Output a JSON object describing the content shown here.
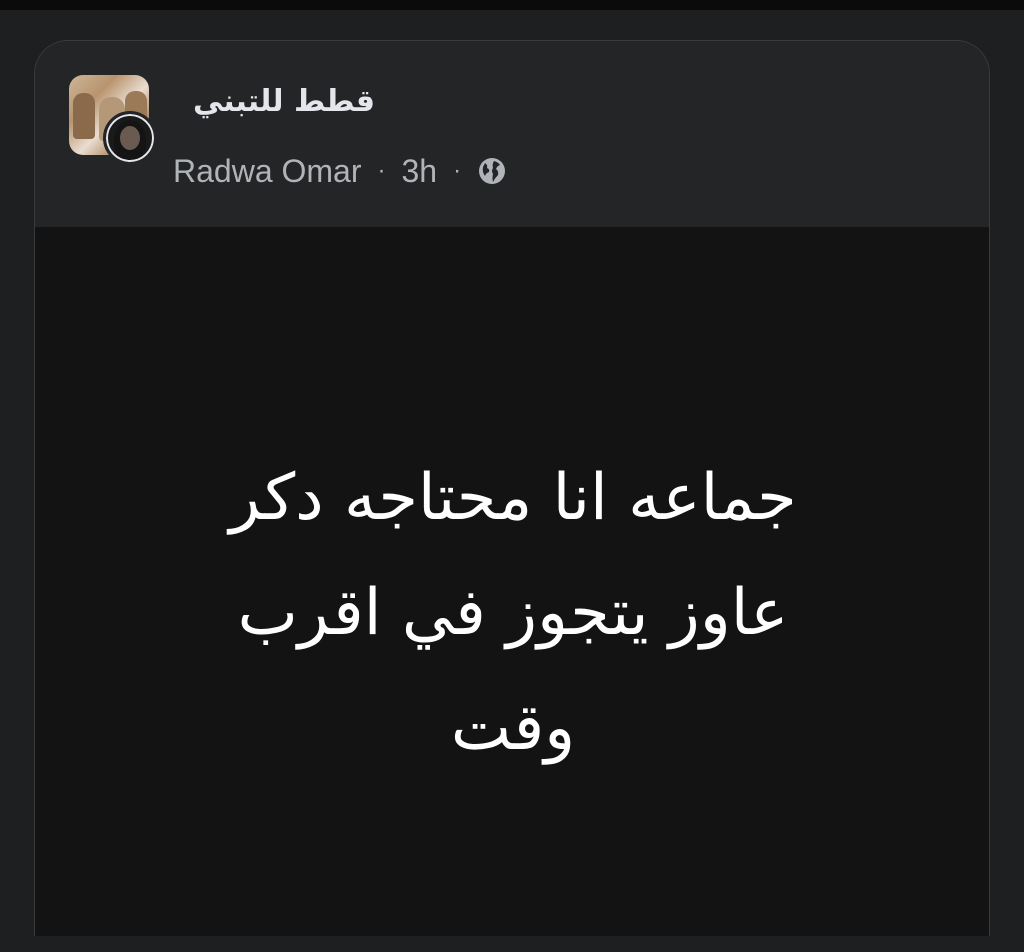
{
  "post": {
    "group_name": "قطط للتبني",
    "author": "Radwa Omar",
    "separator": "·",
    "time": "3h",
    "privacy_icon": "globe-icon",
    "text_lines": [
      "جماعه انا محتاجه دكر",
      "عاوز يتجوز في اقرب",
      "وقت"
    ]
  },
  "colors": {
    "background": "#1e1f21",
    "card": "#242527",
    "post_body": "#131313",
    "primary_text": "#e4e6eb",
    "secondary_text": "#b0b3b8"
  }
}
